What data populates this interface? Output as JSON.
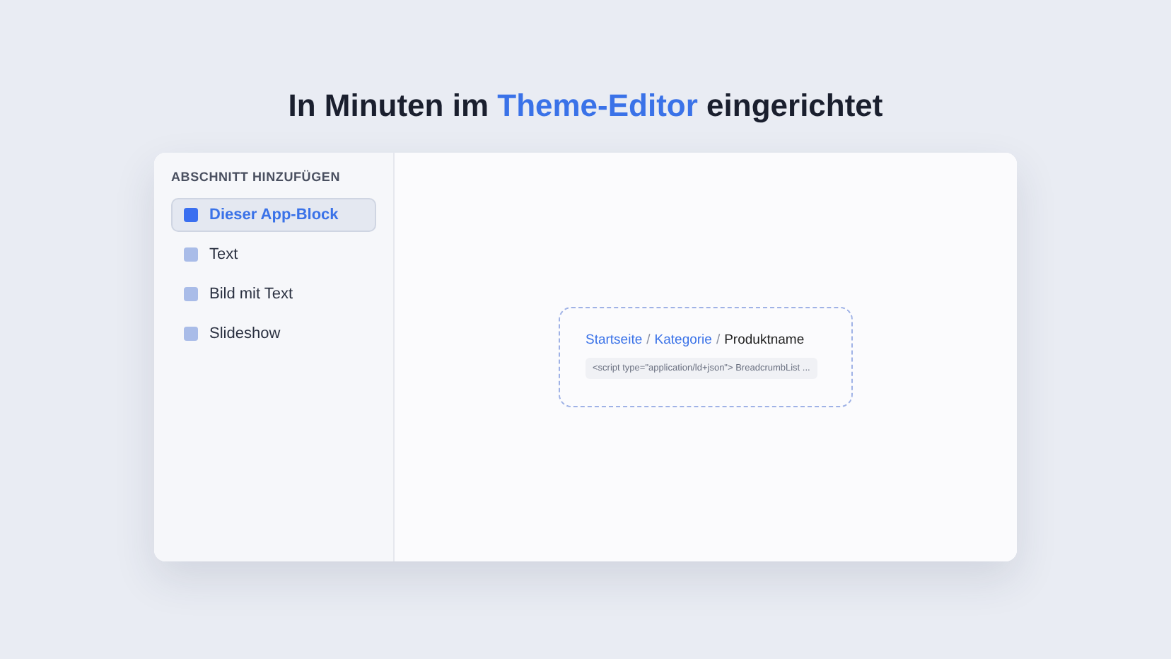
{
  "heading": {
    "before": "In Minuten im",
    "highlight": "Theme-Editor",
    "after": "eingerichtet"
  },
  "sidebar": {
    "title": "ABSCHNITT HINZUFÜGEN",
    "items": [
      {
        "label": "Dieser App-Block",
        "selected": true
      },
      {
        "label": "Text",
        "selected": false
      },
      {
        "label": "Bild mit Text",
        "selected": false
      },
      {
        "label": "Slideshow",
        "selected": false
      }
    ]
  },
  "preview": {
    "breadcrumb": [
      {
        "label": "Startseite",
        "kind": "link"
      },
      {
        "label": "/",
        "kind": "separator"
      },
      {
        "label": "Kategorie",
        "kind": "link"
      },
      {
        "label": "/",
        "kind": "separator"
      },
      {
        "label": "Produktname",
        "kind": "current"
      }
    ],
    "code": "<script type=\"application/ld+json\"> BreadcrumbList ..."
  }
}
